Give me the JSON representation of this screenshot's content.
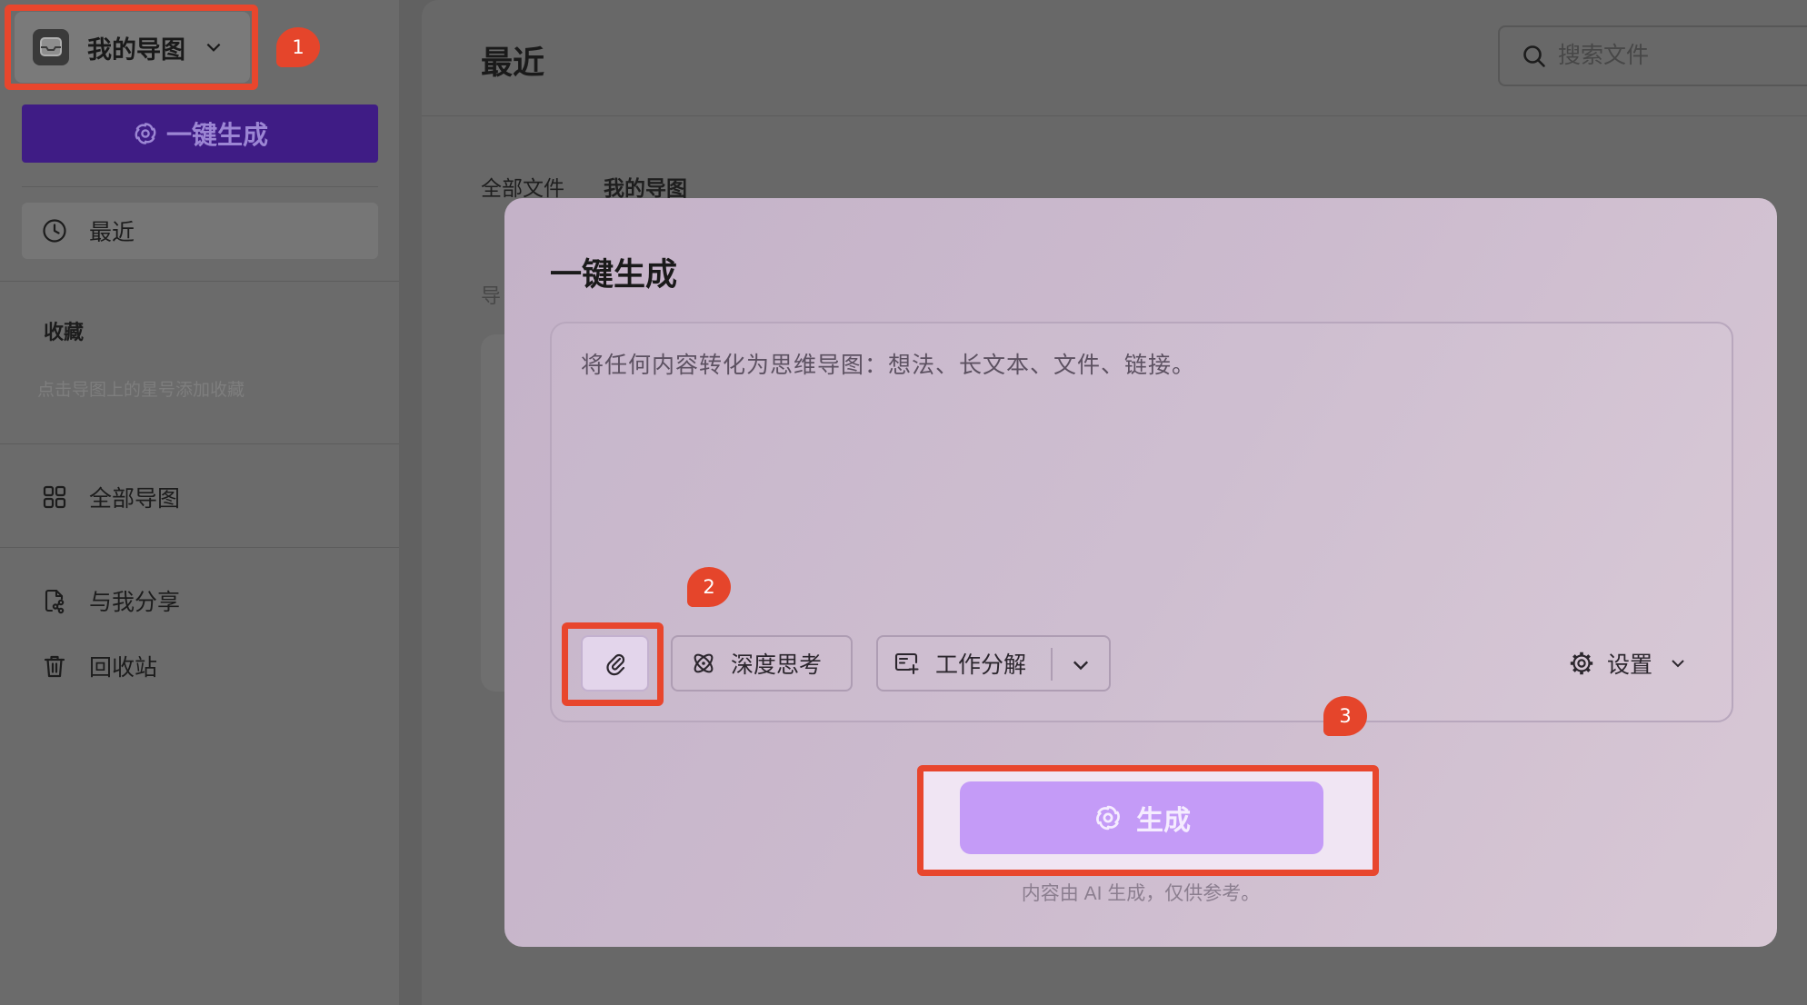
{
  "workspace": {
    "name": "我的导图",
    "icon": "tray-icon"
  },
  "sidebar": {
    "generate": {
      "label": "一键生成",
      "icon": "ai-sparkle-icon"
    },
    "nav": {
      "recent": {
        "label": "最近",
        "icon": "clock-icon",
        "selected": true
      },
      "all_maps": {
        "label": "全部导图",
        "icon": "grid-icon"
      },
      "shared": {
        "label": "与我分享",
        "icon": "share-file-icon"
      },
      "trash": {
        "label": "回收站",
        "icon": "trash-icon"
      }
    },
    "favorites": {
      "title": "收藏",
      "hint": "点击导图上的星号添加收藏"
    }
  },
  "main": {
    "title": "最近",
    "search": {
      "placeholder": "搜索文件",
      "icon": "search-icon"
    },
    "tabs": [
      {
        "label": "全部文件",
        "active": false
      },
      {
        "label": "我的导图",
        "active": true
      }
    ],
    "section_label": "导"
  },
  "modal": {
    "title": "一键生成",
    "input": {
      "value": "",
      "placeholder": "将任何内容转化为思维导图：想法、长文本、文件、链接。"
    },
    "toolbar": {
      "attach": {
        "icon": "paperclip-icon"
      },
      "deep_think": {
        "label": "深度思考",
        "icon": "atom-icon"
      },
      "work_breakdown": {
        "label": "工作分解",
        "icon": "task-list-icon"
      },
      "settings": {
        "label": "设置",
        "icon": "gear-icon"
      }
    },
    "generate": {
      "label": "生成",
      "icon": "ai-sparkle-icon"
    },
    "disclaimer": "内容由 AI 生成，仅供参考。"
  },
  "annotations": [
    {
      "number": "1"
    },
    {
      "number": "2"
    },
    {
      "number": "3"
    }
  ],
  "colors": {
    "annotation_red": "#e8462d",
    "sidebar_generate_bg": "#3f1c85",
    "generate_button_bg": "#c49bf7",
    "modal_bg": "#ccbbce"
  }
}
